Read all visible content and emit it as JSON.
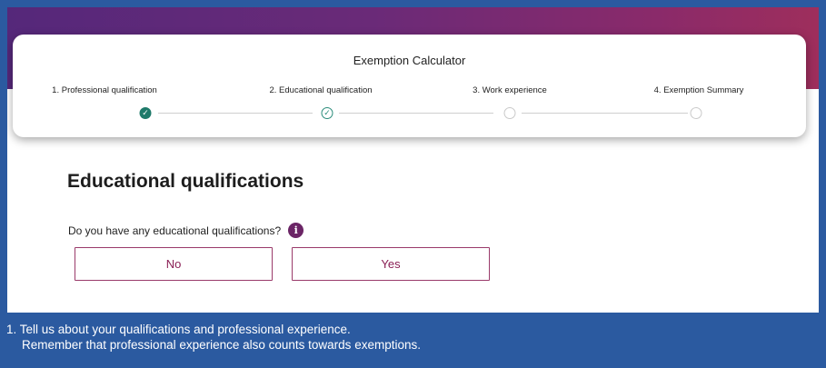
{
  "stepper": {
    "title": "Exemption Calculator",
    "steps": [
      {
        "label": "1. Professional qualification",
        "status": "done"
      },
      {
        "label": "2. Educational qualification",
        "status": "active"
      },
      {
        "label": "3. Work experience",
        "status": "pending"
      },
      {
        "label": "4. Exemption Summary",
        "status": "pending"
      }
    ]
  },
  "main": {
    "heading": "Educational qualifications",
    "question": "Do you have any educational qualifications?",
    "info_icon": "info-icon",
    "options": {
      "no": "No",
      "yes": "Yes"
    }
  },
  "caption": {
    "line1": "1. Tell us about your qualifications and professional experience.",
    "line2": "Remember that professional experience also counts towards exemptions."
  },
  "colors": {
    "accent": "#8a1f55",
    "step_done": "#1f7a6a",
    "caption_bg": "#2b5aa0"
  }
}
